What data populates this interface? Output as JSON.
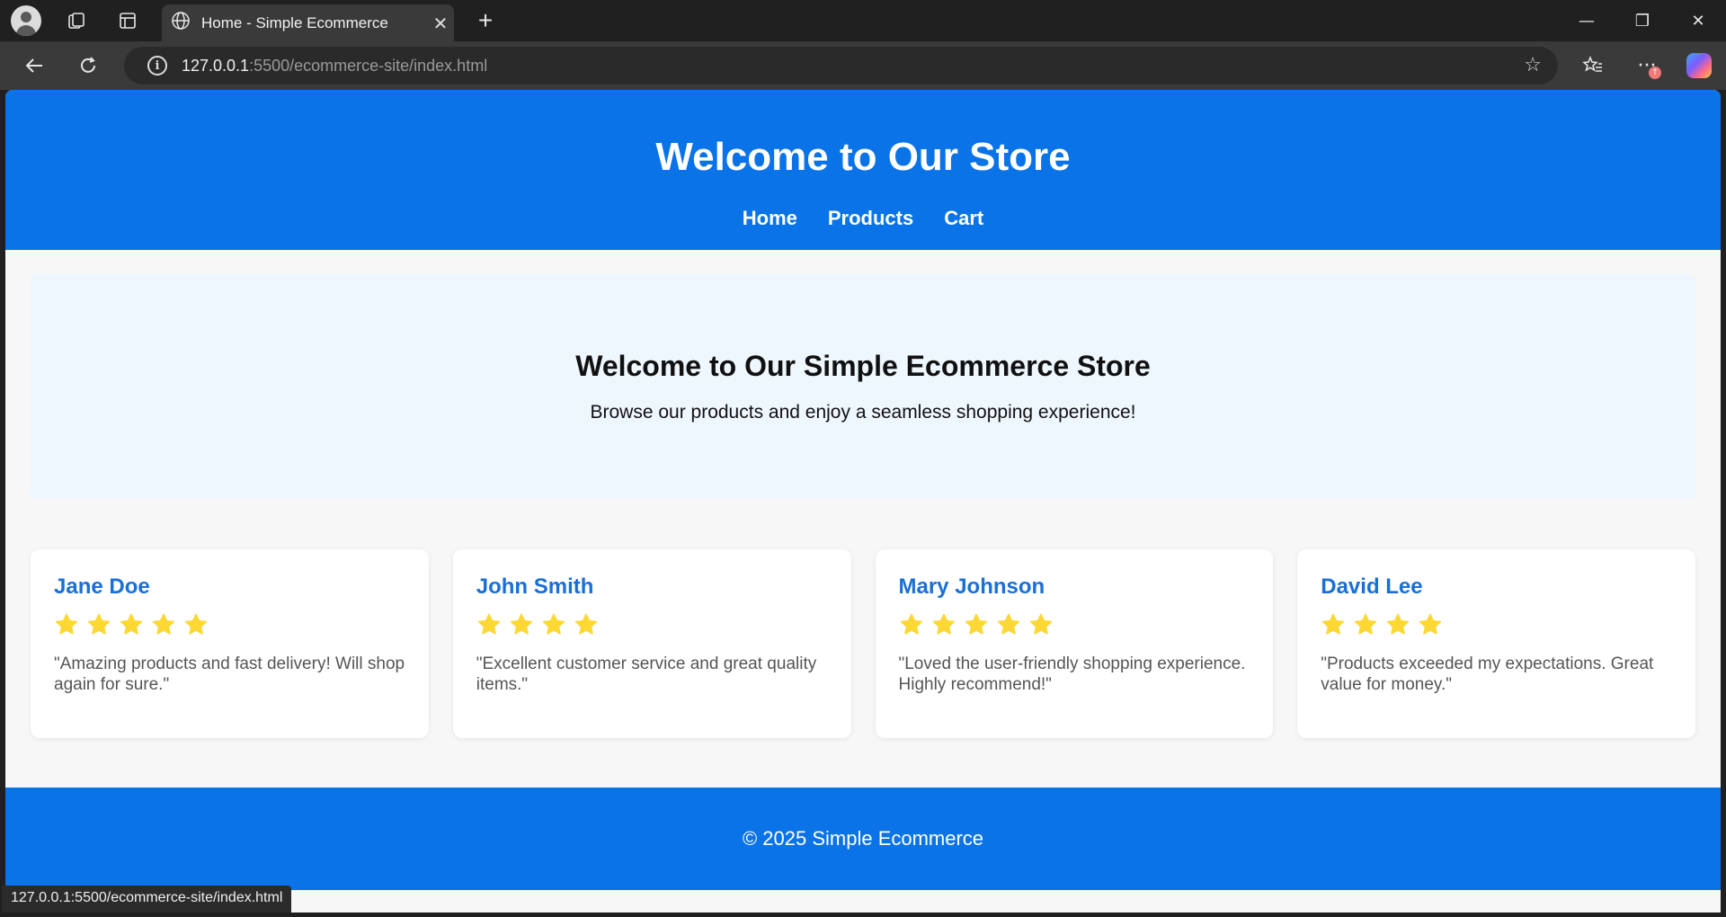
{
  "browser": {
    "tab_title": "Home - Simple Ecommerce",
    "tab_close": "✕",
    "new_tab": "+",
    "url_host": "127.0.0.1",
    "url_rest": ":5500/ecommerce-site/index.html",
    "window_controls": {
      "minimize": "—",
      "restore": "❐",
      "close": "✕"
    },
    "more_label": "···",
    "badge_label": "↑",
    "status_url": "127.0.0.1:5500/ecommerce-site/index.html"
  },
  "header": {
    "title": "Welcome to Our Store",
    "nav": [
      "Home",
      "Products",
      "Cart"
    ]
  },
  "hero": {
    "heading": "Welcome to Our Simple Ecommerce Store",
    "subtitle": "Browse our products and enjoy a seamless shopping experience!"
  },
  "reviews": [
    {
      "name": "Jane Doe",
      "rating": 5,
      "text": "\"Amazing products and fast delivery! Will shop again for sure.\""
    },
    {
      "name": "John Smith",
      "rating": 4,
      "text": "\"Excellent customer service and great quality items.\""
    },
    {
      "name": "Mary Johnson",
      "rating": 5,
      "text": "\"Loved the user-friendly shopping experience. Highly recommend!\""
    },
    {
      "name": "David Lee",
      "rating": 4,
      "text": "\"Products exceeded my expectations. Great value for money.\""
    }
  ],
  "footer": {
    "text": "© 2025 Simple Ecommerce"
  },
  "colors": {
    "brand": "#0a73e8",
    "star": "#fdd835",
    "reviewer": "#1a6fd6"
  }
}
